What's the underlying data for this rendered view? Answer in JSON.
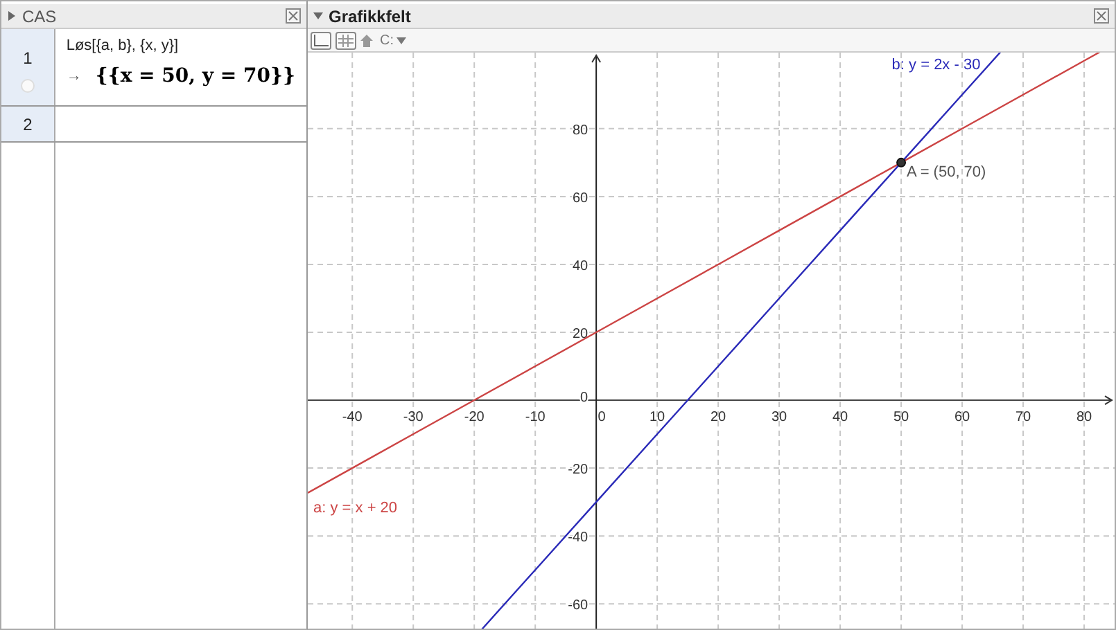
{
  "cas": {
    "title": "CAS",
    "rows": [
      {
        "number": "1",
        "input": "Løs[{a, b}, {x, y}]",
        "arrow": "→",
        "output": "{{x = 50, y = 70}}"
      },
      {
        "number": "2"
      }
    ]
  },
  "graphics": {
    "title": "Grafikkfelt",
    "toolbar": {
      "menu_label": "C:"
    },
    "chart_data": {
      "type": "line",
      "x": [
        -47.3,
        -40,
        -30,
        -20,
        -10,
        0,
        10,
        20,
        30,
        40,
        50,
        60,
        70,
        80
      ],
      "series": [
        {
          "name": "a: y = x + 20",
          "color": "#cc4444",
          "values": [
            -27.3,
            -20,
            -10,
            0,
            10,
            20,
            30,
            40,
            50,
            60,
            70,
            80,
            90,
            100
          ]
        },
        {
          "name": "b: y = 2x - 30",
          "color": "#2a2ab8",
          "values": [
            null,
            null,
            null,
            null,
            -50,
            -30,
            -10,
            10,
            30,
            50,
            70,
            90,
            null,
            null
          ]
        }
      ],
      "grid": true,
      "xlim": [
        -47.3,
        85
      ],
      "ylim": [
        -67.3,
        102.4
      ],
      "xticks": [
        -40,
        -30,
        -20,
        -10,
        0,
        10,
        20,
        30,
        40,
        50,
        60,
        70,
        80
      ],
      "yticks": [
        -60,
        -40,
        -20,
        0,
        20,
        40,
        60,
        80
      ],
      "annotations": [
        {
          "x": 50,
          "y": 70,
          "text": "A = (50, 70)"
        }
      ]
    }
  }
}
